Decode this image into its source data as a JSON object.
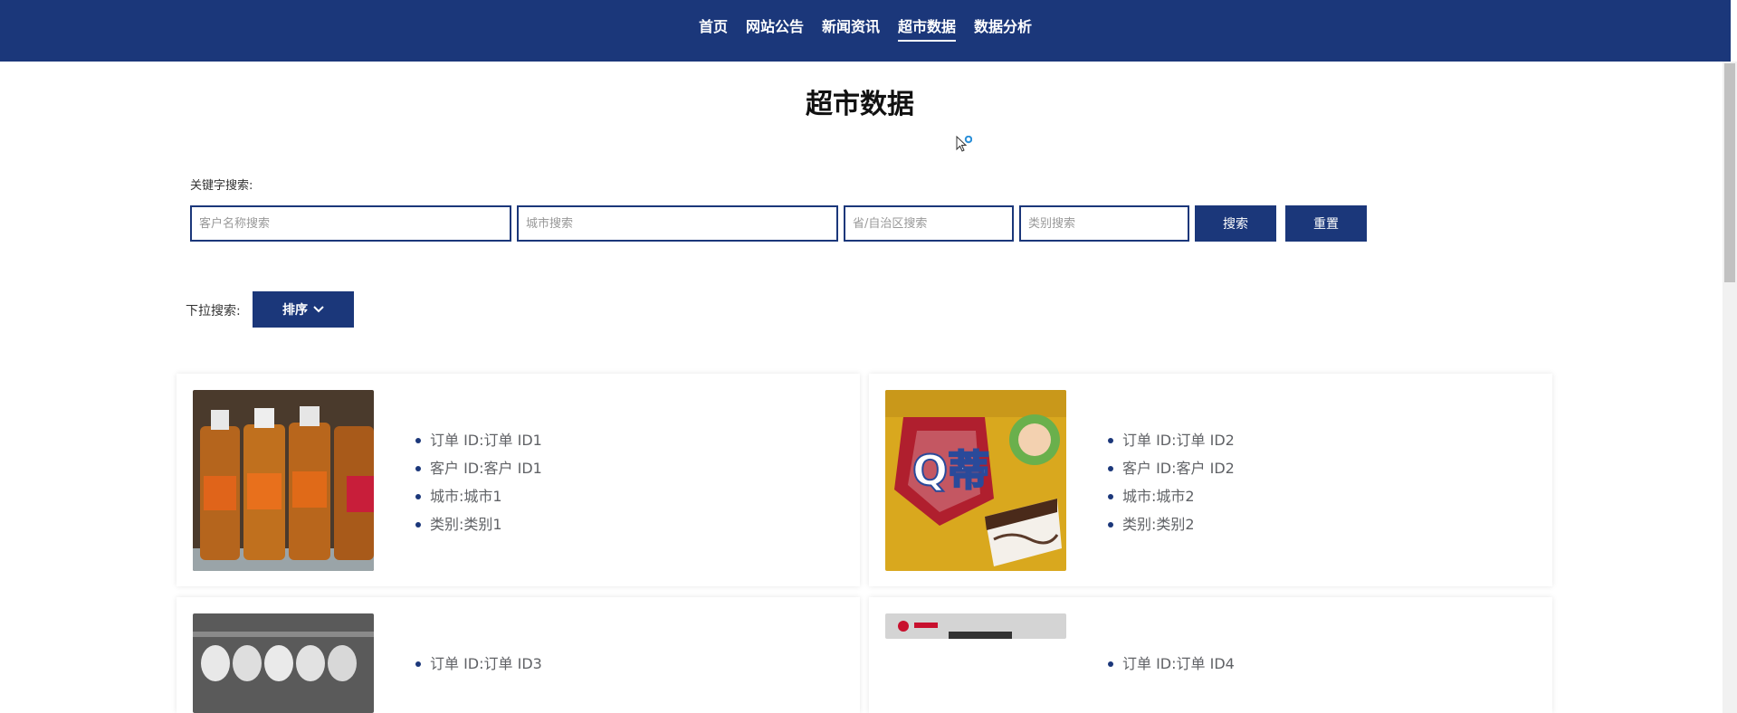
{
  "nav": {
    "items": [
      {
        "label": "首页",
        "active": false
      },
      {
        "label": "网站公告",
        "active": false
      },
      {
        "label": "新闻资讯",
        "active": false
      },
      {
        "label": "超市数据",
        "active": true
      },
      {
        "label": "数据分析",
        "active": false
      }
    ]
  },
  "page": {
    "title": "超市数据"
  },
  "search": {
    "label": "关键字搜索:",
    "customer_placeholder": "客户名称搜索",
    "city_placeholder": "城市搜索",
    "province_placeholder": "省/自治区搜索",
    "category_placeholder": "类别搜索",
    "search_button": "搜索",
    "reset_button": "重置"
  },
  "dropdown": {
    "label": "下拉搜索:",
    "sort_button": "排序"
  },
  "cards": [
    {
      "order": "订单 ID:订单 ID1",
      "customer": "客户 ID:客户 ID1",
      "city": "城市:城市1",
      "category": "类别:类别1"
    },
    {
      "order": "订单 ID:订单 ID2",
      "customer": "客户 ID:客户 ID2",
      "city": "城市:城市2",
      "category": "类别:类别2",
      "image_text": "Q蒂"
    },
    {
      "order": "订单 ID:订单 ID3"
    },
    {
      "order": "订单 ID:订单 ID4"
    }
  ],
  "colors": {
    "primary": "#1b377a",
    "text": "#606266",
    "background": "#ffffff"
  }
}
